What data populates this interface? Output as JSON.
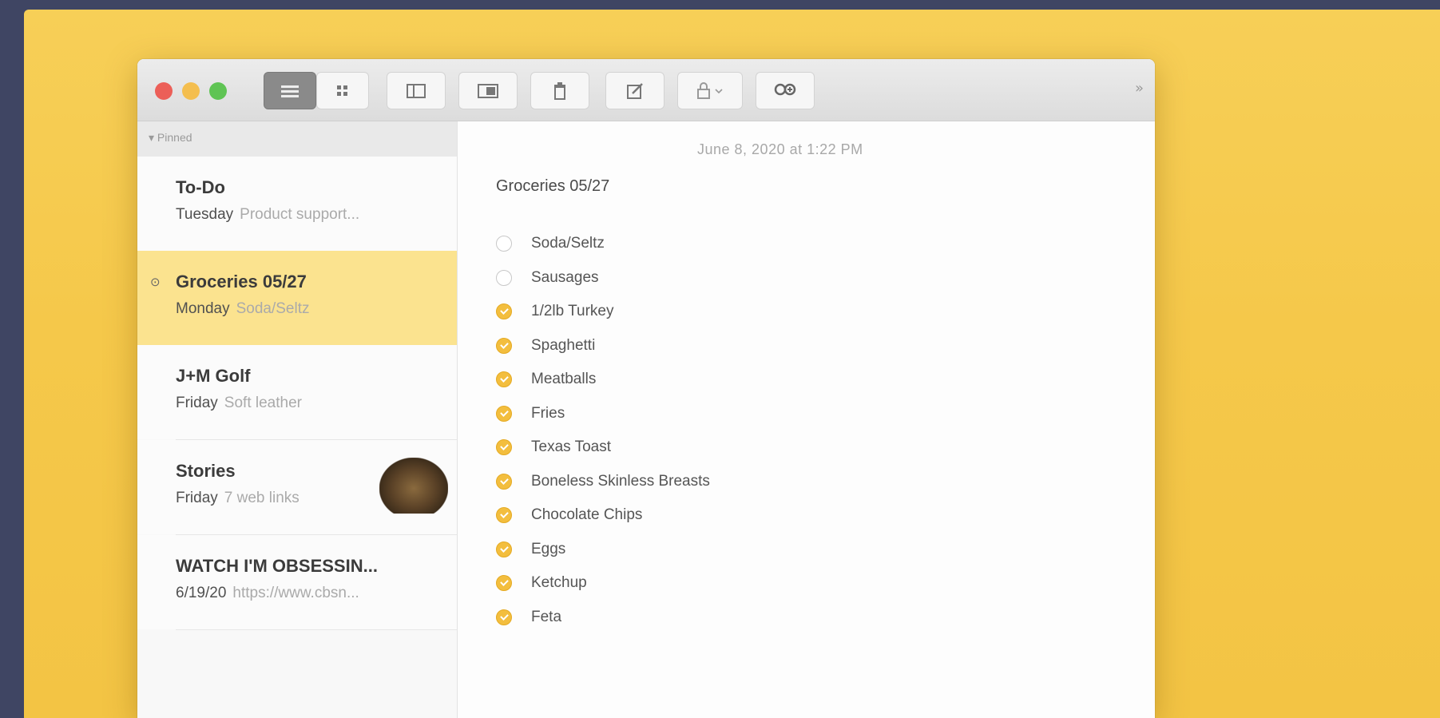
{
  "toolbar": {
    "buttons": [
      {
        "name": "list-view-icon"
      },
      {
        "name": "gallery-view-icon"
      },
      {
        "name": "sidebar-toggle-icon"
      },
      {
        "name": "attachments-icon"
      },
      {
        "name": "trash-icon"
      },
      {
        "name": "compose-icon"
      },
      {
        "name": "lock-icon"
      },
      {
        "name": "collaborate-icon"
      }
    ],
    "more_label": "»"
  },
  "sidebar": {
    "sort_label": "▾ Pinned",
    "notes": [
      {
        "title": "To-Do",
        "date": "Tuesday",
        "preview": "Product support...",
        "selected": false,
        "pinned": false
      },
      {
        "title": "Groceries 05/27",
        "date": "Monday",
        "preview": "Soda/Seltz",
        "selected": true,
        "pinned": true
      },
      {
        "title": "J+M Golf",
        "date": "Friday",
        "preview": "Soft leather",
        "selected": false,
        "pinned": false
      },
      {
        "title": "Stories",
        "date": "Friday",
        "preview": "7 web links",
        "selected": false,
        "pinned": false,
        "has_thumbnail": true
      },
      {
        "title": "WATCH I'M OBSESSIN...",
        "date": "6/19/20",
        "preview": "https://www.cbsn...",
        "selected": false,
        "pinned": false
      }
    ]
  },
  "note": {
    "date": "June 8, 2020 at 1:22 PM",
    "heading": "Groceries 05/27",
    "items": [
      {
        "text": "Soda/Seltz",
        "checked": false
      },
      {
        "text": "Sausages",
        "checked": false
      },
      {
        "text": "1/2lb Turkey",
        "checked": true
      },
      {
        "text": "Spaghetti",
        "checked": true
      },
      {
        "text": "Meatballs",
        "checked": true
      },
      {
        "text": "Fries",
        "checked": true
      },
      {
        "text": "Texas Toast",
        "checked": true
      },
      {
        "text": "Boneless Skinless Breasts",
        "checked": true
      },
      {
        "text": "Chocolate Chips",
        "checked": true
      },
      {
        "text": "Eggs",
        "checked": true
      },
      {
        "text": "Ketchup",
        "checked": true
      },
      {
        "text": "Feta",
        "checked": true
      }
    ]
  },
  "colors": {
    "accent": "#f3be3e",
    "selected_row": "#fbe38f",
    "background": "#f5c84a"
  }
}
